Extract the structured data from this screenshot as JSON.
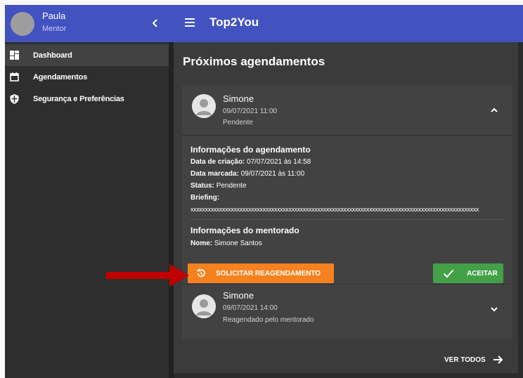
{
  "user": {
    "name": "Paula",
    "role": "Mentor"
  },
  "app": {
    "title": "Top2You"
  },
  "nav": [
    {
      "label": "Dashboard",
      "icon": "dashboard-icon",
      "active": true
    },
    {
      "label": "Agendamentos",
      "icon": "calendar-icon",
      "active": false
    },
    {
      "label": "Segurança e Preferências",
      "icon": "shield-icon",
      "active": false
    }
  ],
  "card": {
    "title": "Próximos agendamentos",
    "view_all": "VER TODOS"
  },
  "appointments": [
    {
      "name": "Simone",
      "datetime": "09/07/2021 11:00",
      "status": "Pendente",
      "expanded": true,
      "info_title": "Informações do agendamento",
      "created_label": "Data de criação:",
      "created_value": "07/07/2021 às 14:58",
      "scheduled_label": "Data marcada:",
      "scheduled_value": "09/07/2021 às 11:00",
      "status_label": "Status:",
      "status_value": "Pendente",
      "briefing_label": "Briefing:",
      "briefing_value": "xxxxxxxxxxxxxxxxxxxxxxxxxxxxxxxxxxxxxxxxxxxxxxxxxxxxxxxxxxxxxxxxxxxxxxxxxxxxxxxxxxxxxxxxxxxxxxxxxxxx",
      "mentee_title": "Informações do mentorado",
      "mentee_name_label": "Nome:",
      "mentee_name_value": "Simone Santos",
      "reschedule_label": "SOLICITAR REAGENDAMENTO",
      "accept_label": "ACEITAR"
    },
    {
      "name": "Simone",
      "datetime": "09/07/2021 14:00",
      "status": "Reagendado pelo mentorado",
      "expanded": false
    }
  ],
  "colors": {
    "primary": "#4253c0",
    "reschedule": "#f5821f",
    "accept": "#43a047",
    "annotation_arrow": "#c00000"
  }
}
